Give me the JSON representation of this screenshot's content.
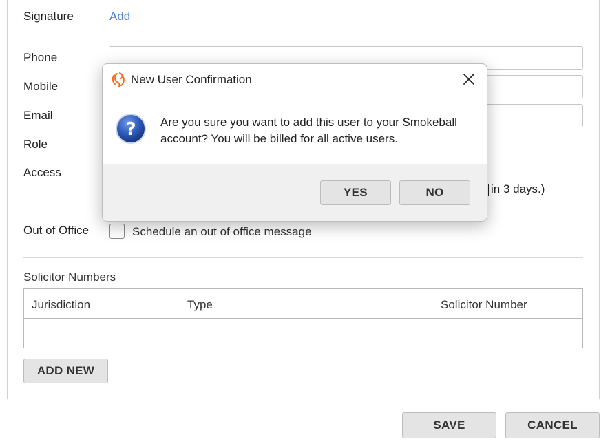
{
  "form": {
    "signature_label": "Signature",
    "signature_add": "Add",
    "phone_label": "Phone",
    "mobile_label": "Mobile",
    "email_label": "Email",
    "role_label": "Role",
    "access_label": "Access",
    "access_trailing_text": "in 3 days.)",
    "out_of_office_label": "Out of Office",
    "out_of_office_checkbox_label": "Schedule an out of office message",
    "solicitor_numbers_title": "Solicitor Numbers",
    "table_headers": [
      "Jurisdiction",
      "Type",
      "Solicitor Number"
    ],
    "add_new_label": "ADD NEW"
  },
  "footer": {
    "save_label": "SAVE",
    "cancel_label": "CANCEL"
  },
  "dialog": {
    "title": "New User Confirmation",
    "message_line1": "Are you sure you want to add this user to your Smokeball",
    "message_line2": "account? You will be billed for all active users.",
    "yes_label": "YES",
    "no_label": "NO",
    "logo_icon": "smokeball-logo-icon",
    "question_icon": "question-icon",
    "logo_color": "#f26b21",
    "question_color": "#2a57b5"
  },
  "colors": {
    "link": "#3c7fd6",
    "button_bg": "#e4e4e4",
    "divider": "#d9d9d9"
  }
}
